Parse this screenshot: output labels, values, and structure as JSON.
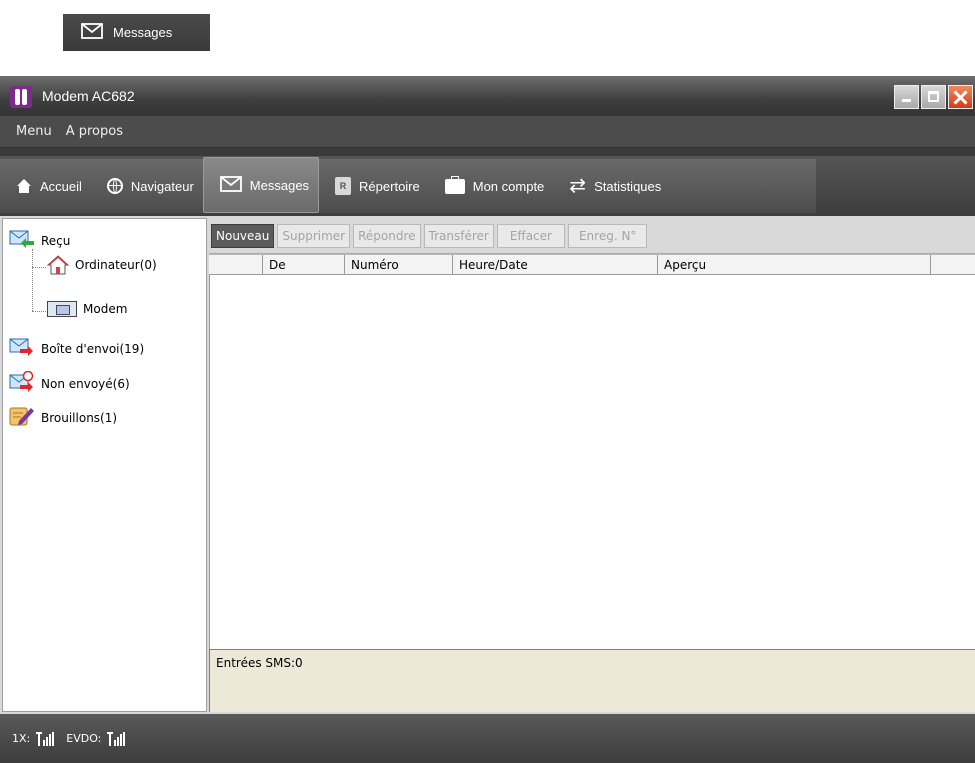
{
  "tooltip": {
    "label": "Messages",
    "icon": "envelope-icon"
  },
  "window": {
    "title": "Modem AC682",
    "controls": [
      "minimize",
      "maximize",
      "close"
    ]
  },
  "menu": {
    "items": [
      "Menu",
      "A propos"
    ]
  },
  "toolbar": {
    "items": [
      {
        "label": "Accueil",
        "icon": "home-icon"
      },
      {
        "label": "Navigateur",
        "icon": "globe-icon"
      },
      {
        "label": "Messages",
        "icon": "envelope-icon",
        "active": true
      },
      {
        "label": "Répertoire",
        "icon": "address-book-icon"
      },
      {
        "label": "Mon compte",
        "icon": "briefcase-icon"
      },
      {
        "label": "Statistiques",
        "icon": "arrows-icon"
      }
    ]
  },
  "sidebar": {
    "items": [
      {
        "label": "Reçu",
        "icon": "inbox-icon"
      },
      {
        "label": "Ordinateur(0)",
        "icon": "house-icon"
      },
      {
        "label": "Modem",
        "icon": "modem-icon"
      },
      {
        "label": "Boîte d'envoi(19)",
        "icon": "outbox-icon"
      },
      {
        "label": "Non envoyé(6)",
        "icon": "unsent-icon"
      },
      {
        "label": "Brouillons(1)",
        "icon": "drafts-icon"
      }
    ]
  },
  "actions": {
    "buttons": [
      {
        "label": "Nouveau",
        "enabled": true
      },
      {
        "label": "Supprimer",
        "enabled": false
      },
      {
        "label": "Répondre",
        "enabled": false
      },
      {
        "label": "Transférer",
        "enabled": false
      },
      {
        "label": "Effacer",
        "enabled": false
      },
      {
        "label": "Enreg. N°",
        "enabled": false
      }
    ]
  },
  "table": {
    "columns": [
      "",
      "De",
      "Numéro",
      "Heure/Date",
      "Aperçu",
      ""
    ],
    "rows": []
  },
  "preview": {
    "text": "Entrées SMS:0"
  },
  "status": {
    "label_1x": "1X:",
    "label_evdo": "EVDO:"
  },
  "colors": {
    "title_bg": "#3e3e3e",
    "accent_purple": "#7c2b8a",
    "close_red": "#d23b1a",
    "preview_bg": "#ece9d8"
  }
}
